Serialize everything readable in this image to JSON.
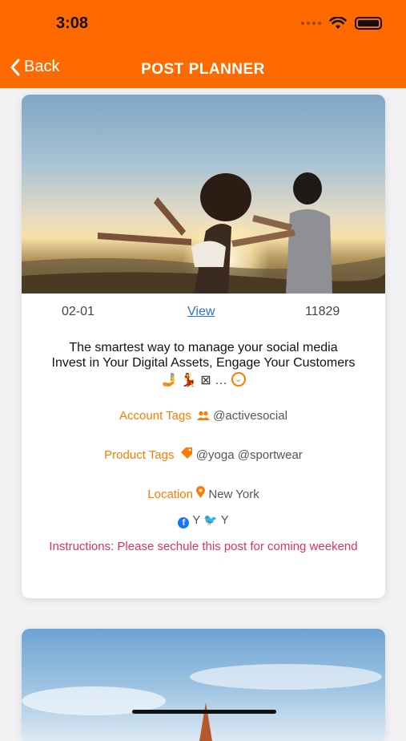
{
  "status_bar": {
    "time": "3:08"
  },
  "nav": {
    "back_label": "Back",
    "title": "POST PLANNER"
  },
  "post": {
    "date": "02-01",
    "view_label": "View",
    "count": "11829",
    "caption_line1": "The smartest way to manage your social media",
    "caption_line2": "Invest in Your Digital Assets, Engage Your Customers",
    "emoji_row": "🤳 💃 ⊠ …",
    "account_tags_label": "Account Tags",
    "account_tags_value": "@activesocial",
    "product_tags_label": "Product Tags",
    "product_tags_value": "@yoga @sportwear",
    "location_label": "Location",
    "location_value": "New York",
    "facebook_value": "Y",
    "twitter_value": "Y",
    "instructions": "Instructions: Please sechule this post for coming weekend"
  },
  "colors": {
    "header": "#ff6a00",
    "accent": "#ff7a00",
    "link": "#2f6fd6",
    "instructions": "#e0335a"
  },
  "icons": [
    "chevron-left-icon",
    "wifi-icon",
    "battery-icon",
    "people-icon",
    "tag-icon",
    "location-pin-icon",
    "facebook-icon",
    "twitter-icon",
    "chevron-down-circle-icon"
  ]
}
